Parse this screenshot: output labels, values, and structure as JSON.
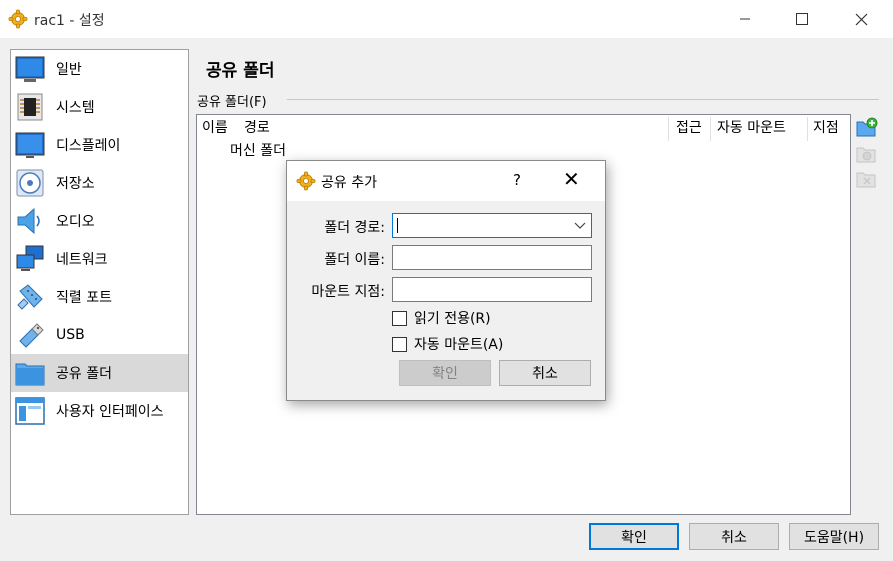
{
  "window": {
    "title": "rac1 - 설정",
    "minimize_glyph": "—",
    "maximize_glyph": "☐",
    "close_glyph": "✕"
  },
  "sidebar": {
    "items": [
      {
        "label": "일반",
        "icon": "general-icon"
      },
      {
        "label": "시스템",
        "icon": "system-chip-icon"
      },
      {
        "label": "디스플레이",
        "icon": "display-icon"
      },
      {
        "label": "저장소",
        "icon": "storage-disc-icon"
      },
      {
        "label": "오디오",
        "icon": "audio-speaker-icon"
      },
      {
        "label": "네트워크",
        "icon": "network-icon"
      },
      {
        "label": "직렬 포트",
        "icon": "serial-port-icon"
      },
      {
        "label": "USB",
        "icon": "usb-icon"
      },
      {
        "label": "공유 폴더",
        "icon": "shared-folder-icon",
        "selected": true
      },
      {
        "label": "사용자 인터페이스",
        "icon": "user-interface-icon"
      }
    ]
  },
  "main": {
    "title": "공유 폴더",
    "group_label": "공유 폴더(F)",
    "table": {
      "columns": [
        "이름",
        "경로",
        "접근",
        "자동 마운트",
        "지점"
      ],
      "rows": [
        "머신 폴더"
      ]
    }
  },
  "footer": {
    "ok": "확인",
    "cancel": "취소",
    "help": "도움말(H)"
  },
  "dialog": {
    "title": "공유 추가",
    "help": "?",
    "close": "✕",
    "path_label": "폴더 경로:",
    "path_value": "",
    "name_label": "폴더 이름:",
    "name_value": "",
    "mount_label": "마운트 지점:",
    "mount_value": "",
    "readonly_label": "읽기 전용(R)",
    "readonly_checked": false,
    "automount_label": "자동 마운트(A)",
    "automount_checked": false,
    "ok": "확인",
    "cancel": "취소"
  },
  "colors": {
    "accent": "#0078d7",
    "selected_item": "#d9d9d9",
    "window_bg": "#f0f0f0"
  }
}
